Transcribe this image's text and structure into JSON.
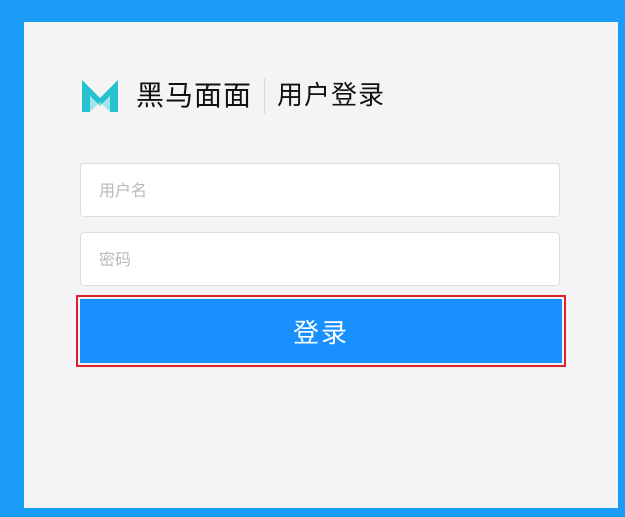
{
  "brand": {
    "logo_icon": "m-logo-icon",
    "name": "黑马面面",
    "page_title": "用户登录"
  },
  "form": {
    "username": {
      "value": "",
      "placeholder": "用户名"
    },
    "password": {
      "value": "",
      "placeholder": "密码"
    },
    "submit_label": "登录"
  },
  "colors": {
    "background": "#1a9bf5",
    "panel": "#f4f4f4",
    "button": "#1890ff",
    "highlight_border": "#e0202a",
    "logo_teal": "#26c1cf"
  }
}
